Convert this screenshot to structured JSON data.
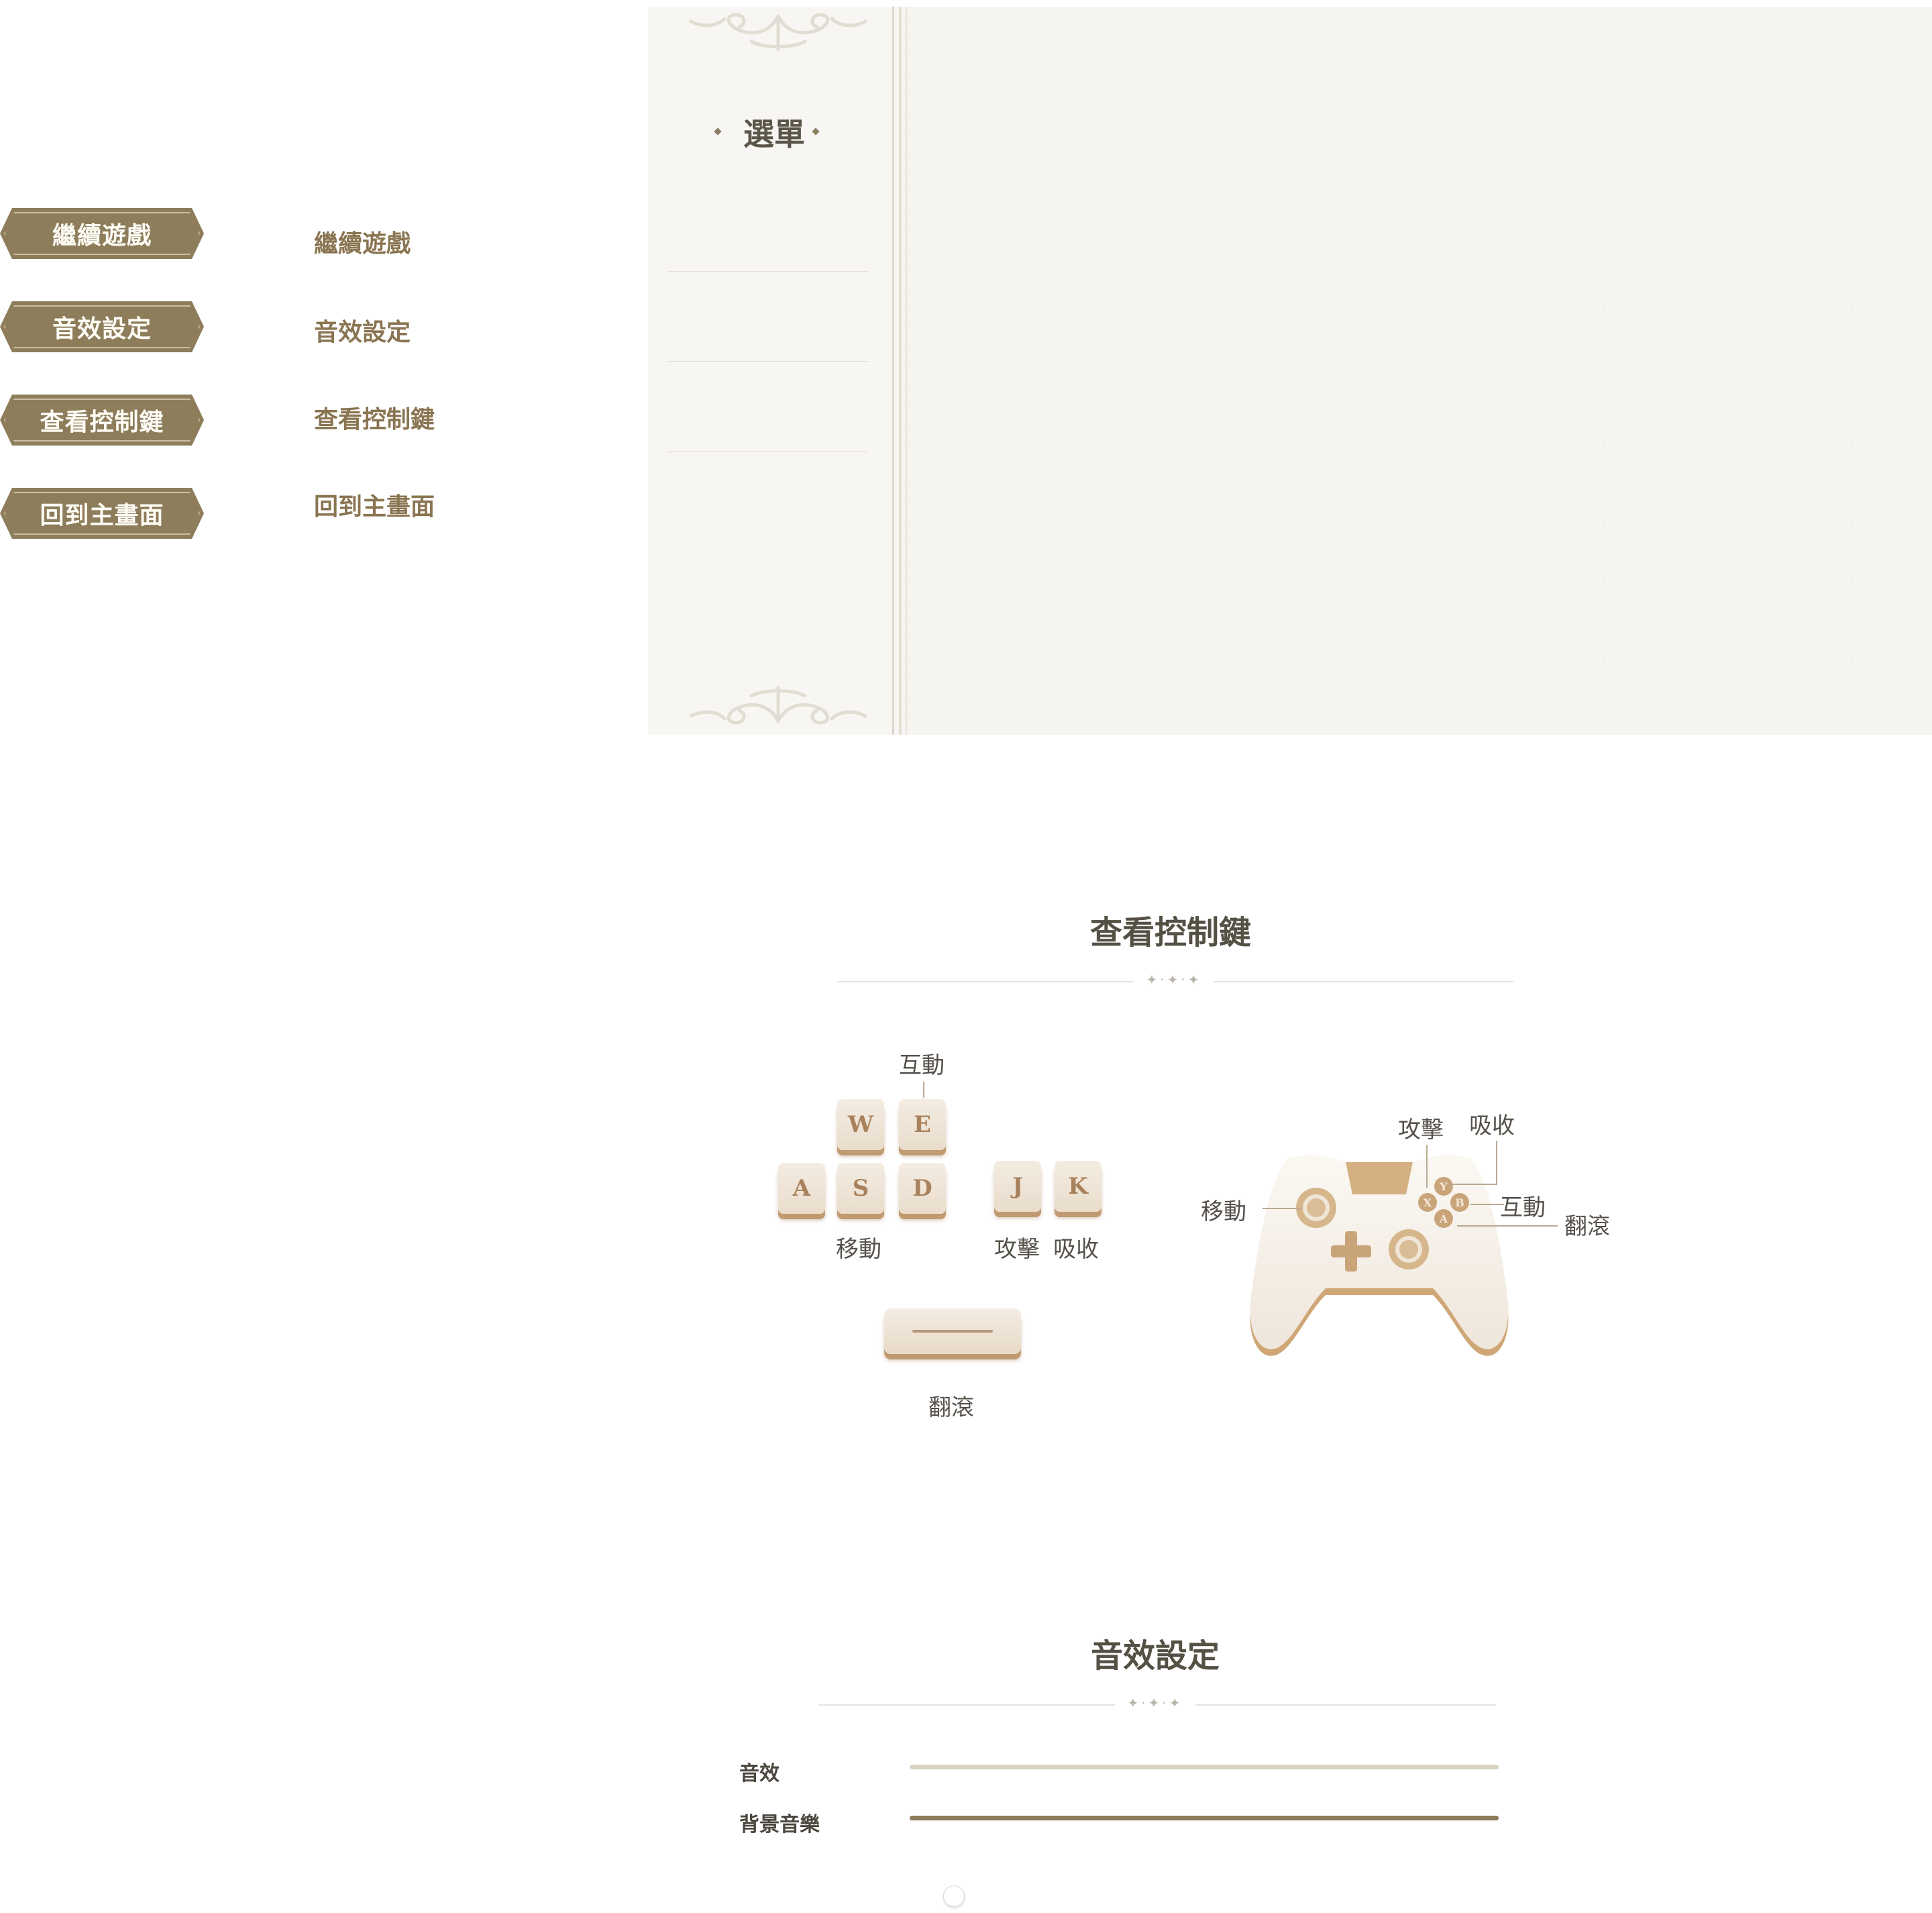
{
  "menu_buttons": [
    {
      "label": "繼續遊戲"
    },
    {
      "label": "音效設定"
    },
    {
      "label": "查看控制鍵"
    },
    {
      "label": "回到主畫面"
    }
  ],
  "menu_labels_plain": [
    {
      "label": "繼續遊戲"
    },
    {
      "label": "音效設定"
    },
    {
      "label": "查看控制鍵"
    },
    {
      "label": "回到主畫面"
    }
  ],
  "menu_panel": {
    "title": "選單"
  },
  "controls": {
    "title": "查看控制鍵",
    "keyboard": {
      "keys": [
        "W",
        "E",
        "A",
        "S",
        "D",
        "J",
        "K"
      ],
      "labels": {
        "interact": "互動",
        "move": "移動",
        "attack": "攻擊",
        "absorb": "吸收",
        "roll": "翻滾"
      }
    },
    "gamepad": {
      "face_buttons": [
        "Y",
        "X",
        "B",
        "A"
      ],
      "labels": {
        "move": "移動",
        "attack": "攻擊",
        "absorb": "吸收",
        "interact": "互動",
        "roll": "翻滾"
      }
    }
  },
  "sound": {
    "title": "音效設定",
    "sfx_label": "音效",
    "bgm_label": "背景音樂",
    "sfx_level": 0,
    "bgm_level": 1.0
  },
  "colors": {
    "button_brown": "#8e7d5b",
    "label_brown": "#8a7552",
    "key_edge": "#c19a70",
    "slider_fill": "#8b7c5c",
    "slider_track": "#d8d3c3"
  }
}
